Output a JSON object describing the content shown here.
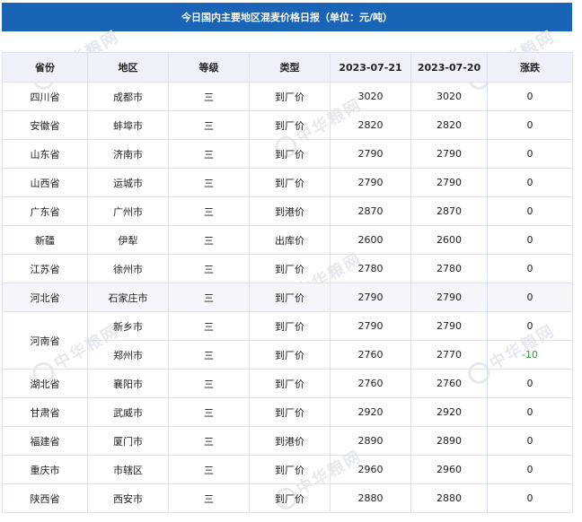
{
  "title": "今日国内主要地区混麦价格日报（单位：元/吨）",
  "watermark": "中华粮网",
  "columns": [
    "省份",
    "地区",
    "等级",
    "类型",
    "2023-07-21",
    "2023-07-20",
    "涨跌"
  ],
  "rows": [
    {
      "province": "四川省",
      "region": "成都市",
      "grade": "三",
      "type": "到厂价",
      "price_0721": "3020",
      "price_0720": "3020",
      "change": "0"
    },
    {
      "province": "安徽省",
      "region": "蚌埠市",
      "grade": "三",
      "type": "到厂价",
      "price_0721": "2820",
      "price_0720": "2820",
      "change": "0"
    },
    {
      "province": "山东省",
      "region": "济南市",
      "grade": "三",
      "type": "到厂价",
      "price_0721": "2790",
      "price_0720": "2790",
      "change": "0"
    },
    {
      "province": "山西省",
      "region": "运城市",
      "grade": "三",
      "type": "到厂价",
      "price_0721": "2790",
      "price_0720": "2790",
      "change": "0"
    },
    {
      "province": "广东省",
      "region": "广州市",
      "grade": "三",
      "type": "到港价",
      "price_0721": "2870",
      "price_0720": "2870",
      "change": "0"
    },
    {
      "province": "新疆",
      "region": "伊犁",
      "grade": "三",
      "type": "出库价",
      "price_0721": "2600",
      "price_0720": "2600",
      "change": "0"
    },
    {
      "province": "江苏省",
      "region": "徐州市",
      "grade": "三",
      "type": "到厂价",
      "price_0721": "2780",
      "price_0720": "2780",
      "change": "0"
    },
    {
      "province": "河北省",
      "region": "石家庄市",
      "grade": "三",
      "type": "到厂价",
      "price_0721": "2790",
      "price_0720": "2790",
      "change": "0"
    },
    {
      "province": "河南省",
      "region": "新乡市",
      "grade": "三",
      "type": "到厂价",
      "price_0721": "2790",
      "price_0720": "2790",
      "change": "0"
    },
    {
      "province": "",
      "region": "郑州市",
      "grade": "三",
      "type": "到厂价",
      "price_0721": "2760",
      "price_0720": "2770",
      "change": "-10"
    },
    {
      "province": "湖北省",
      "region": "襄阳市",
      "grade": "三",
      "type": "到厂价",
      "price_0721": "2760",
      "price_0720": "2760",
      "change": "0"
    },
    {
      "province": "甘肃省",
      "region": "武威市",
      "grade": "三",
      "type": "到厂价",
      "price_0721": "2920",
      "price_0720": "2920",
      "change": "0"
    },
    {
      "province": "福建省",
      "region": "厦门市",
      "grade": "三",
      "type": "到港价",
      "price_0721": "2890",
      "price_0720": "2890",
      "change": "0"
    },
    {
      "province": "重庆市",
      "region": "市辖区",
      "grade": "三",
      "type": "到厂价",
      "price_0721": "2960",
      "price_0720": "2960",
      "change": "0"
    },
    {
      "province": "陕西省",
      "region": "西安市",
      "grade": "三",
      "type": "到厂价",
      "price_0721": "2880",
      "price_0720": "2880",
      "change": "0"
    }
  ]
}
